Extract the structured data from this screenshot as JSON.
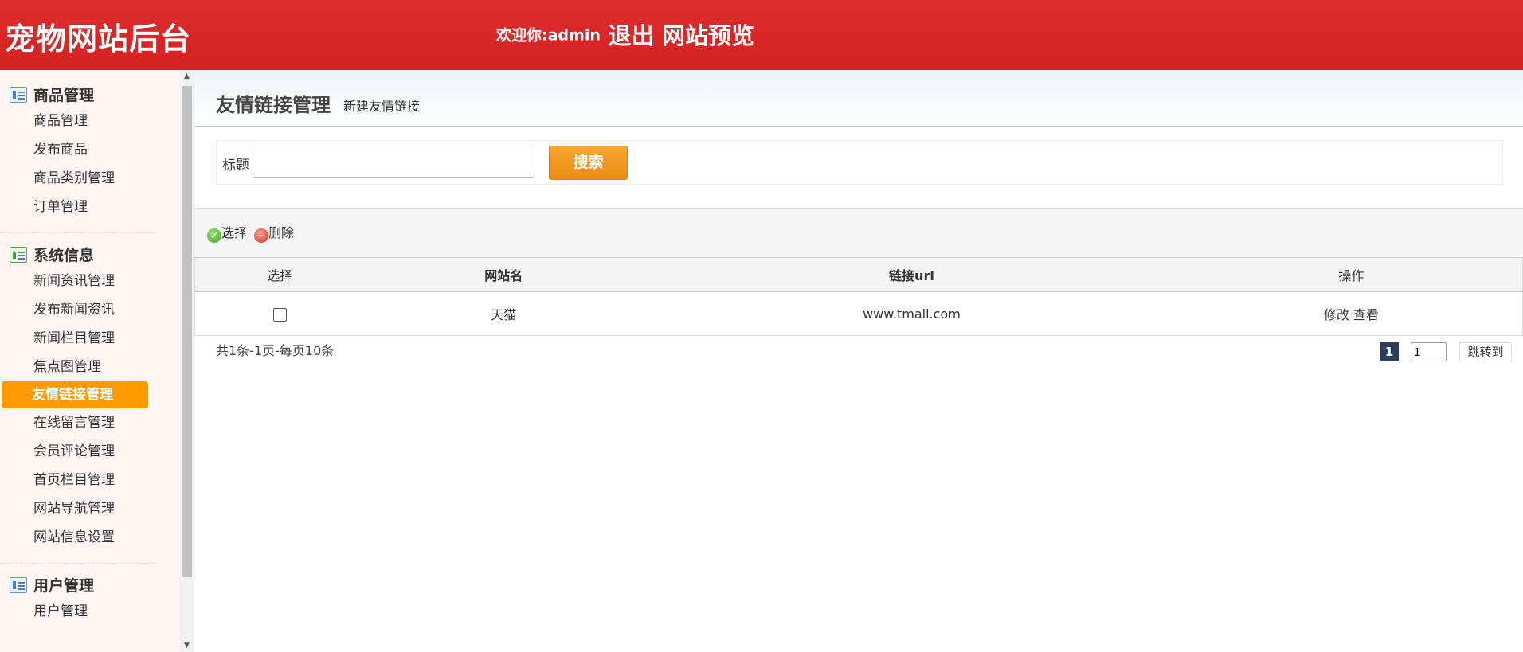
{
  "header": {
    "site_title": "宠物网站后台",
    "welcome": "欢迎你:admin",
    "logout": "退出",
    "preview": "网站预览"
  },
  "sidebar": {
    "groups": [
      {
        "title": "商品管理",
        "items": [
          "商品管理",
          "发布商品",
          "商品类别管理",
          "订单管理"
        ]
      },
      {
        "title": "系统信息",
        "items": [
          "新闻资讯管理",
          "发布新闻资讯",
          "新闻栏目管理",
          "焦点图管理",
          "友情链接管理",
          "在线留言管理",
          "会员评论管理",
          "首页栏目管理",
          "网站导航管理",
          "网站信息设置"
        ],
        "active_item": "友情链接管理"
      },
      {
        "title": "用户管理",
        "items": [
          "用户管理"
        ]
      }
    ]
  },
  "page": {
    "title": "友情链接管理",
    "subtitle": "新建友情链接"
  },
  "search": {
    "label": "标题",
    "value": "",
    "button": "搜索"
  },
  "toolbar": {
    "select": "选择",
    "delete": "删除"
  },
  "table": {
    "headers": [
      "选择",
      "网站名",
      "链接url",
      "操作"
    ],
    "rows": [
      {
        "checked": false,
        "name": "天猫",
        "url": "www.tmall.com",
        "edit": "修改",
        "view": "查看"
      }
    ]
  },
  "pager": {
    "info": "共1条-1页-每页10条",
    "current_page": "1",
    "input_value": "1",
    "jump": "跳转到"
  },
  "colors": {
    "header_red": "#d42222",
    "active_orange": "#ff9900",
    "search_button": "#ec8c12"
  }
}
